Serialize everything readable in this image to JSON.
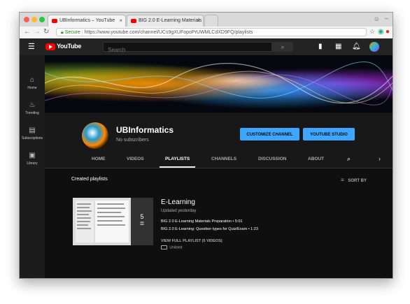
{
  "browser": {
    "tabs": [
      {
        "title": "UBInformatics – YouTube",
        "active": true
      },
      {
        "title": "BIG 2.0 E-Learning Materials",
        "active": false
      }
    ],
    "secure_label": "Secure",
    "url": "https://www.youtube.com/channel/UCs9gXUFopoPrUWMLCdXD9FQ/playlists"
  },
  "youtube": {
    "logo_text": "YouTube",
    "search_placeholder": "Search"
  },
  "sidebar": {
    "items": [
      {
        "label": "Home",
        "icon": "home-icon"
      },
      {
        "label": "Trending",
        "icon": "flame-icon"
      },
      {
        "label": "Subscriptions",
        "icon": "subscriptions-icon"
      },
      {
        "label": "Library",
        "icon": "library-icon"
      }
    ]
  },
  "channel": {
    "name": "UBInformatics",
    "subscribers": "No subscribers",
    "customize_button": "CUSTOMIZE CHANNEL",
    "studio_button": "YOUTUBE STUDIO",
    "tabs": [
      "HOME",
      "VIDEOS",
      "PLAYLISTS",
      "CHANNELS",
      "DISCUSSION",
      "ABOUT"
    ],
    "selected_tab": "PLAYLISTS"
  },
  "content": {
    "section_title": "Created playlists",
    "sort_label": "SORT BY",
    "playlist": {
      "name": "E-Learning",
      "updated": "Updated yesterday",
      "count": "5",
      "videos": [
        "BIG 2.0 E-Learning Materials Preparation • 5:01",
        "BIG 2.0 E-Learning: Question types for Quiz/Exam • 1:23"
      ],
      "view_full": "VIEW FULL PLAYLIST (5 VIDEOS)",
      "visibility": "Unlisted"
    }
  },
  "colors": {
    "accent_blue": "#3ea6ff",
    "youtube_red": "#ff0000",
    "background": "#181818"
  }
}
